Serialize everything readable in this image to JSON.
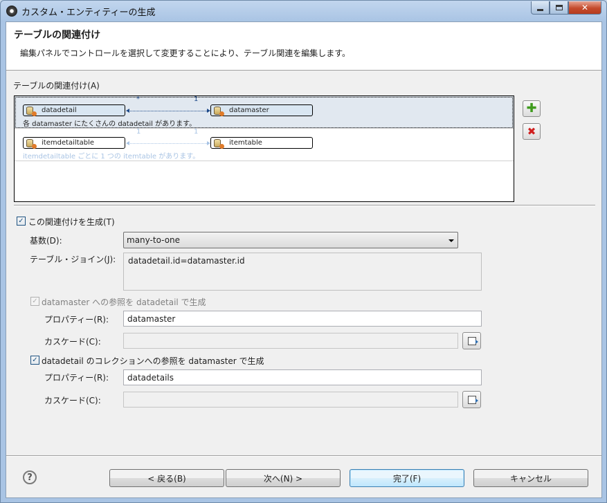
{
  "window": {
    "title": "カスタム・エンティティーの生成",
    "minimize_glyph": "",
    "maximize_glyph": "",
    "close_glyph": "✕"
  },
  "header": {
    "title": "テーブルの関連付け",
    "description": "編集パネルでコントロールを選択して変更することにより、テーブル関連を編集します。"
  },
  "associations": {
    "label": "テーブルの関連付け(A)",
    "rows": [
      {
        "source": "datadetail",
        "target": "datamaster",
        "source_multiplicity": "*",
        "target_multiplicity": "1",
        "description": "各 datamaster にたくさんの datadetail があります。",
        "selected": true
      },
      {
        "source": "itemdetailtable",
        "target": "itemtable",
        "source_multiplicity": "1",
        "target_multiplicity": "1",
        "description": "itemdetailtable ごとに 1 つの itemtable があります。",
        "selected": false
      }
    ],
    "add_icon": "plus-icon",
    "delete_icon": "delete-icon",
    "add_glyph": "✚",
    "delete_glyph": "✖"
  },
  "form": {
    "generate_checkbox_label": "この関連付けを生成(T)",
    "generate_checked": true,
    "cardinality_label": "基数(D):",
    "cardinality_value": "many-to-one",
    "join_label": "テーブル・ジョイン(J):",
    "join_value": "datadetail.id=datamaster.id",
    "ref1": {
      "checkbox_label": "datamaster への参照を datadetail で生成",
      "checked": true,
      "disabled": true,
      "property_label": "プロパティー(R):",
      "property_value": "datamaster",
      "cascade_label": "カスケード(C):",
      "cascade_value": ""
    },
    "ref2": {
      "checkbox_label": "datadetail のコレクションへの参照を datamaster で生成",
      "checked": true,
      "disabled": false,
      "property_label": "プロパティー(R):",
      "property_value": "datadetails",
      "cascade_label": "カスケード(C):",
      "cascade_value": ""
    },
    "check_glyph": "✓"
  },
  "footer": {
    "help_glyph": "?",
    "back_label": "< 戻る(B)",
    "next_label": "次へ(N) >",
    "finish_label": "完了(F)",
    "cancel_label": "キャンセル"
  }
}
